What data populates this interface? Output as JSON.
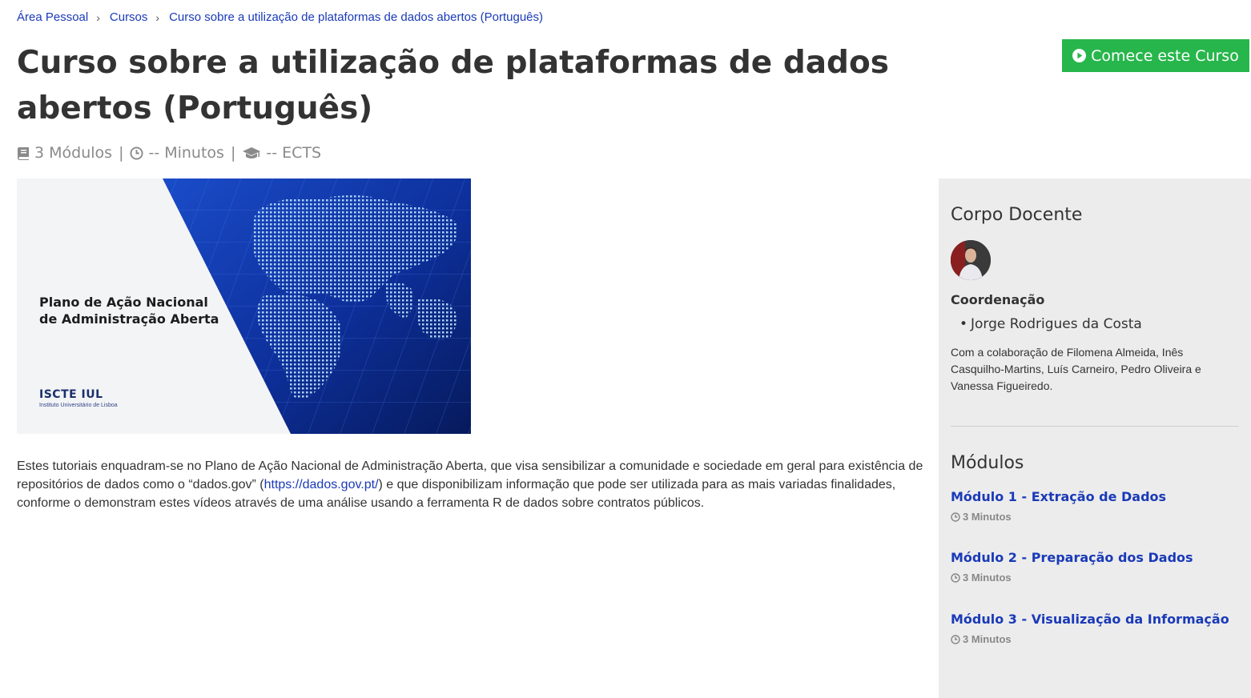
{
  "breadcrumb": {
    "items": [
      "Área Pessoal",
      "Cursos",
      "Curso sobre a utilização de plataformas de dados abertos (Português)"
    ]
  },
  "course": {
    "title": "Curso sobre a utilização de plataformas de dados abertos (Português)",
    "start_button": "Comece este Curso",
    "meta": {
      "modules": "3 Módulos",
      "minutes": "-- Minutos",
      "ects": "-- ECTS"
    },
    "image": {
      "caption_line1": "Plano de Ação Nacional",
      "caption_line2": "de Administração Aberta",
      "logo_text": "ISCTE IUL",
      "logo_sub": "Instituto Universitário de Lisboa"
    },
    "description": {
      "before_link": "Estes tutoriais enquadram-se no Plano de Ação Nacional de Administração Aberta, que visa sensibilizar a comunidade e sociedade em geral para existência de repositórios de dados como o “dados.gov” (",
      "link": "https://dados.gov.pt/",
      "after_link": ") e que disponibilizam informação que pode ser utilizada para as mais variadas finalidades, conforme o demonstram estes vídeos através de uma análise usando a ferramenta R de dados sobre contratos públicos."
    }
  },
  "sidebar": {
    "faculty_title": "Corpo Docente",
    "role": "Coordenação",
    "coordinator": "Jorge Rodrigues da Costa",
    "collaboration": "Com a colaboração de Filomena Almeida, Inês Casquilho-Martins, Luís Carneiro, Pedro Oliveira e Vanessa Figueiredo.",
    "modules_title": "Módulos",
    "modules": [
      {
        "title": "Módulo 1 - Extração de Dados",
        "duration": "3 Minutos"
      },
      {
        "title": "Módulo 2 - Preparação dos Dados",
        "duration": "3 Minutos"
      },
      {
        "title": "Módulo 3 - Visualização da Informação",
        "duration": "3 Minutos"
      }
    ]
  },
  "colors": {
    "link": "#1a3ab8",
    "start_button": "#27b64b",
    "sidebar_bg": "#ececec"
  },
  "icons": [
    "chevron-right-icon",
    "play-circle-icon",
    "book-icon",
    "clock-icon",
    "graduation-cap-icon"
  ]
}
